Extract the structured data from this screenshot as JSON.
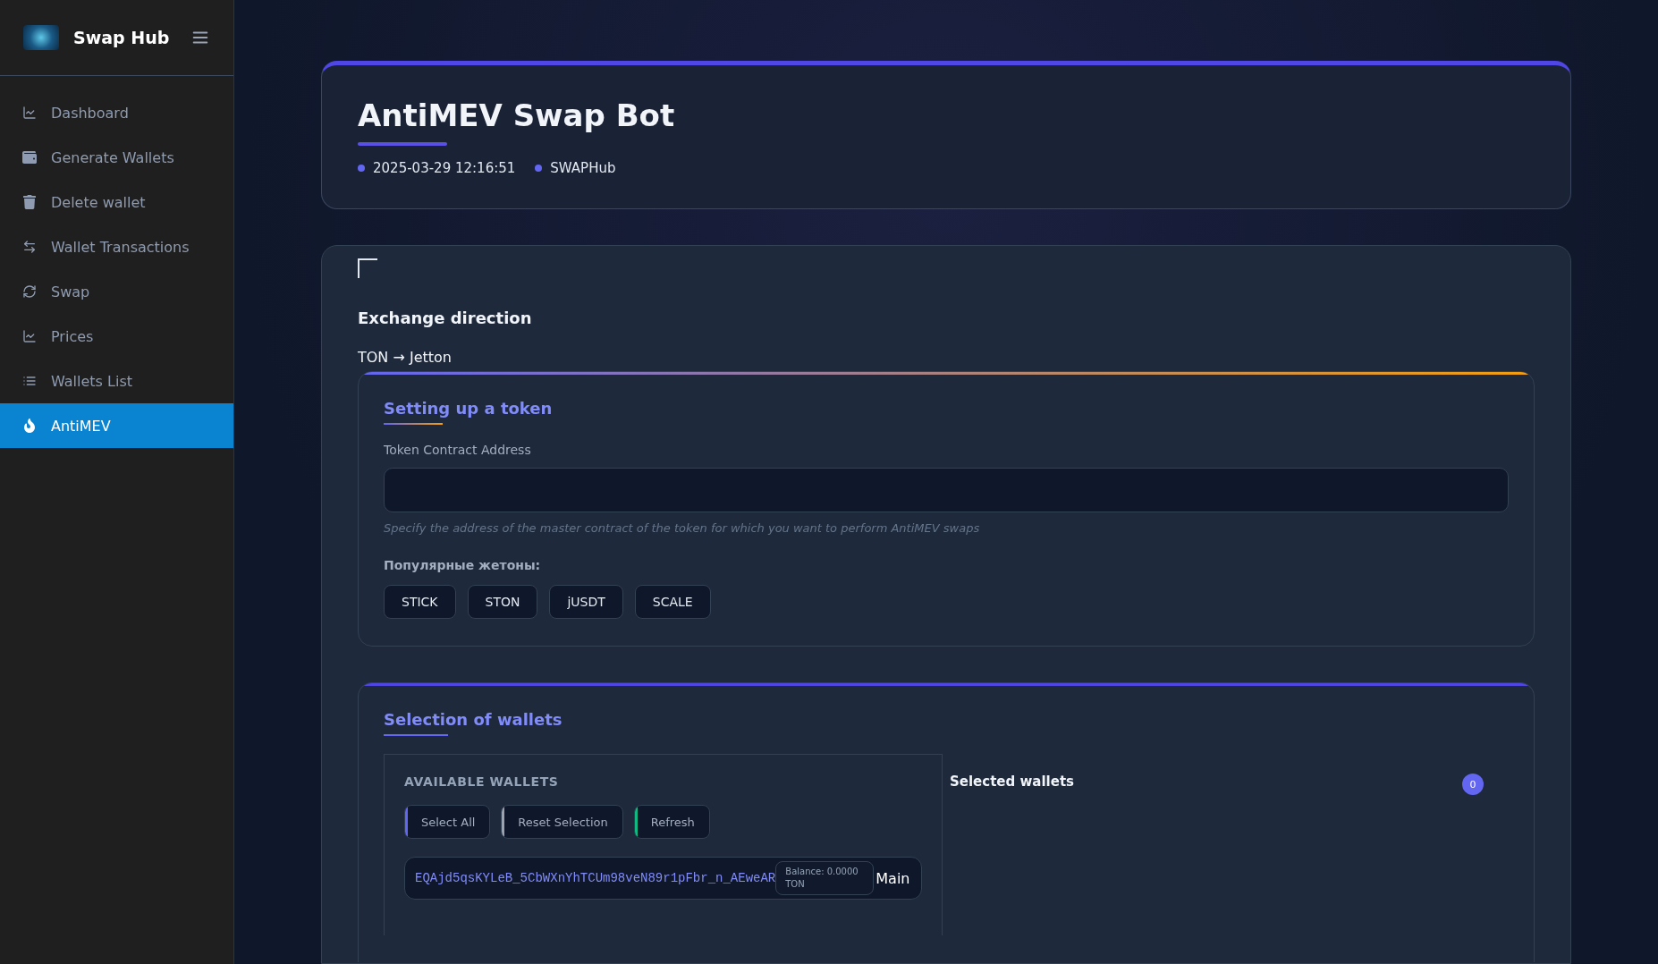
{
  "sidebar": {
    "brand": "Swap Hub",
    "items": [
      {
        "label": "Dashboard",
        "kind": "chart",
        "selected": false
      },
      {
        "label": "Generate Wallets",
        "kind": "wallet",
        "selected": false
      },
      {
        "label": "Delete wallet",
        "kind": "trash",
        "selected": false
      },
      {
        "label": "Wallet Transactions",
        "kind": "arrows",
        "selected": false
      },
      {
        "label": "Swap",
        "kind": "refresh",
        "selected": false
      },
      {
        "label": "Prices",
        "kind": "chart",
        "selected": false
      },
      {
        "label": "Wallets List",
        "kind": "list",
        "selected": false
      },
      {
        "label": "AntiMEV",
        "kind": "fire",
        "selected": true
      }
    ]
  },
  "header": {
    "title": "AntiMEV Swap Bot",
    "meta": [
      "2025-03-29 12:16:51",
      "SWAPHub"
    ]
  },
  "exchange": {
    "title": "Exchange direction",
    "value": "TON → Jetton"
  },
  "token": {
    "title": "Setting up a token",
    "label": "Token Contract Address",
    "hint": "Specify the address of the master contract of the token for which you want to perform AntiMEV swaps",
    "popular_label": "Популярные жетоны:",
    "popular": [
      "STICK",
      "STON",
      "jUSDT",
      "SCALE"
    ]
  },
  "wallets": {
    "title": "Selection of wallets",
    "available_title": "AVAILABLE WALLETS",
    "buttons": [
      {
        "label": "Select All",
        "color": "#6366f1"
      },
      {
        "label": "Reset Selection",
        "color": "#9ca3af"
      },
      {
        "label": "Refresh",
        "color": "#10b981"
      }
    ],
    "list": [
      {
        "address": "EQAjd5qsKYLeB_5CbWXnYhTCUm98veN89r1pFbr_n_AEweAR",
        "balance": "Balance: 0.0000 TON",
        "tag": "Main"
      }
    ],
    "selected_title": "Selected wallets",
    "selected_count": "0"
  }
}
